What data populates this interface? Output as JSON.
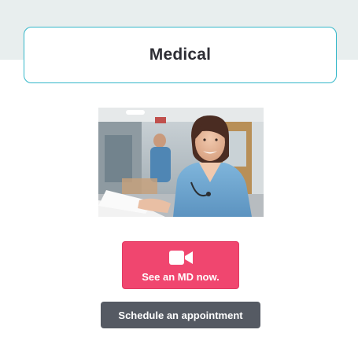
{
  "header": {
    "title": "Medical"
  },
  "hero_image": {
    "alt": "Smiling doctor in scrubs at a desk"
  },
  "cta": {
    "label": "See an MD now.",
    "icon": "video-camera-icon",
    "color": "#f0466f"
  },
  "schedule": {
    "label": "Schedule an appointment",
    "color": "#555a63"
  },
  "colors": {
    "accent_border": "#33b7c9",
    "top_band": "#e8eeee"
  }
}
